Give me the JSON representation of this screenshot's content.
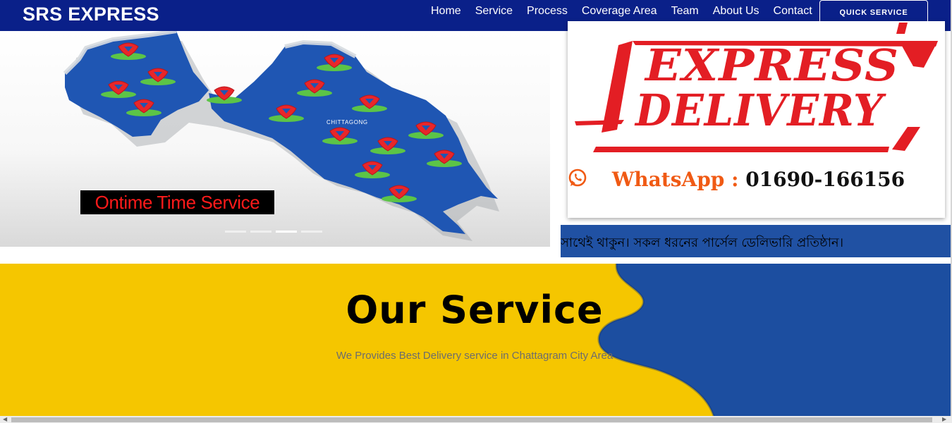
{
  "brand": "SRS EXPRESS",
  "nav": {
    "items": [
      "Home",
      "Service",
      "Process",
      "Coverage Area",
      "Team",
      "About Us",
      "Contact"
    ],
    "cta": "QUICK SERVICE"
  },
  "slider": {
    "map_label": "CHITTAGONG",
    "caption": "Ontime Time Service",
    "slides": 4,
    "active_slide": 3
  },
  "express": {
    "line1": "EXPRESS",
    "line2": "DELIVERY",
    "whatsapp_label": "WhatsApp :",
    "whatsapp_number": "01690-166156"
  },
  "marquee": {
    "text": "সাথেই থাকুন। সকল ধরনের পার্সেল ডেলিভারি প্রতিষ্ঠান।"
  },
  "service": {
    "title": "Our Service",
    "subtitle": "We Provides Best Delivery service in Chattagram City Area"
  },
  "colors": {
    "navbar": "#0a2089",
    "map_blue": "#1f56b3",
    "pin_red": "#e8262a",
    "express_red": "#e31e24",
    "whatsapp_orange": "#f05a14",
    "service_yellow": "#f5c600",
    "service_blue": "#1c4ea0"
  }
}
